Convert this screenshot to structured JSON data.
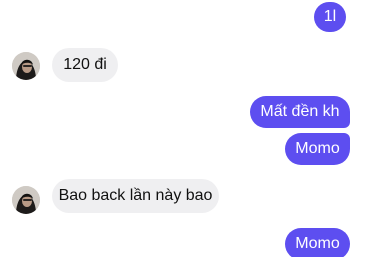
{
  "messages": [
    {
      "id": "m1",
      "direction": "outgoing",
      "text": "1l"
    },
    {
      "id": "m2",
      "direction": "incoming",
      "text": "120 đi"
    },
    {
      "id": "m3",
      "direction": "outgoing",
      "text": "Mất đền kh"
    },
    {
      "id": "m4",
      "direction": "outgoing",
      "text": "Momo"
    },
    {
      "id": "m5",
      "direction": "incoming",
      "text": "Bao back lần này bao"
    },
    {
      "id": "m6",
      "direction": "outgoing",
      "text": "Momo"
    }
  ],
  "colors": {
    "outgoing_bubble": "#5d4ef0",
    "incoming_bubble": "#efeff1",
    "background": "#ffffff"
  },
  "icons": {
    "contact_avatar": "person-photo-avatar"
  }
}
